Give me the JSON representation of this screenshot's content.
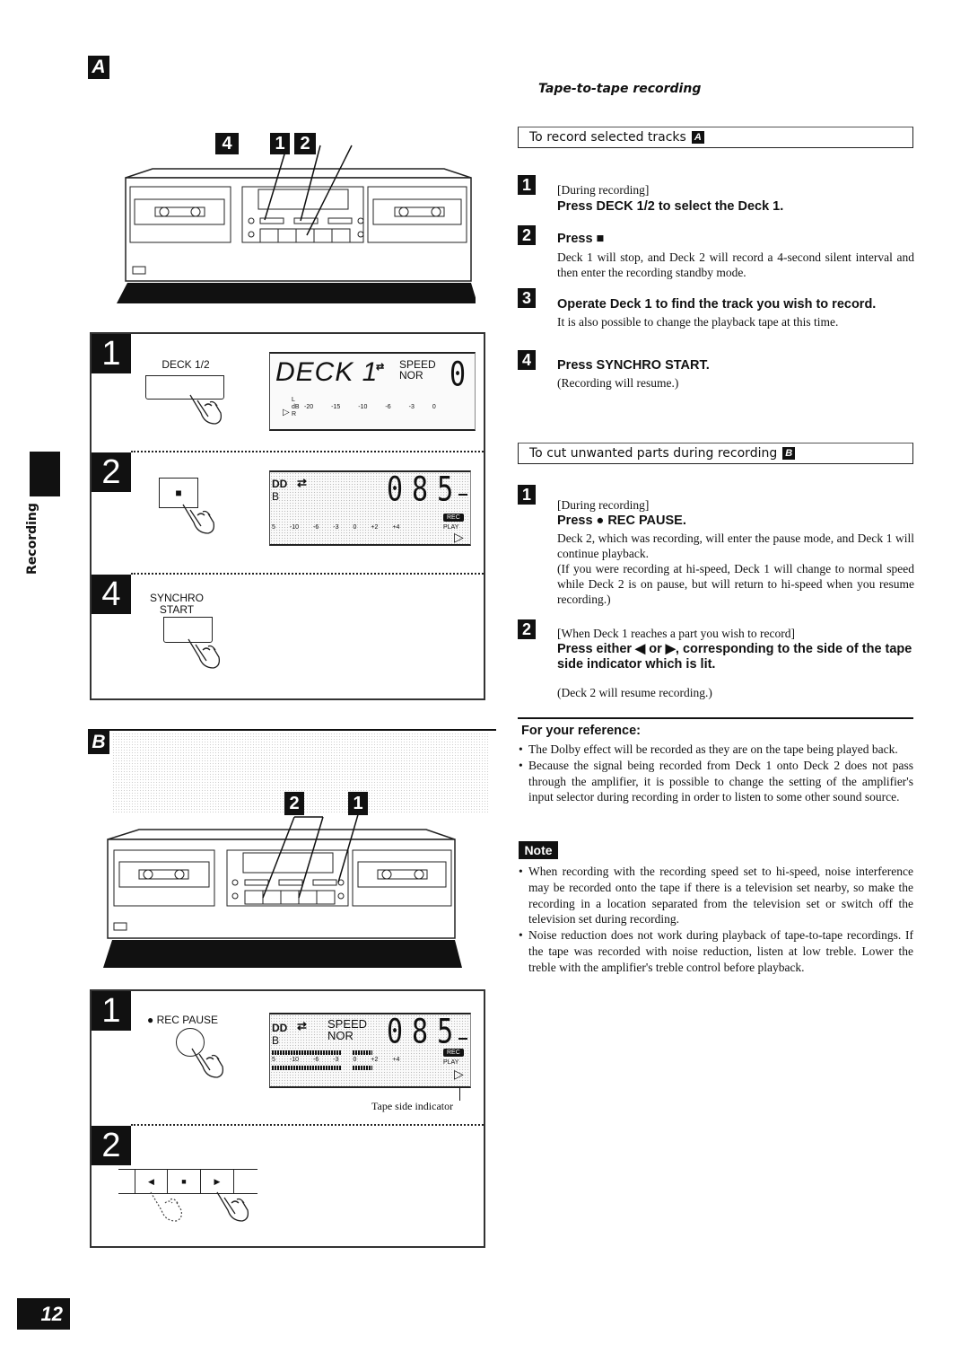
{
  "page": {
    "section_letter_a": "A",
    "section_letter_b": "B",
    "side_tab_label": "Recording",
    "page_number": "12"
  },
  "header": {
    "title": "Tape-to-tape recording"
  },
  "section_a": {
    "title": "To record selected tracks",
    "badge": "A",
    "steps": [
      {
        "num": "1",
        "condition": "[During recording]",
        "instruction": "Press DECK 1/2 to select the Deck 1.",
        "description": ""
      },
      {
        "num": "2",
        "condition": "",
        "instruction": "Press ■",
        "description": "Deck 1 will stop, and Deck 2 will record a 4-second silent interval and then enter the recording standby mode."
      },
      {
        "num": "3",
        "condition": "",
        "instruction": "Operate Deck 1 to find the track you wish to record.",
        "description": "It is also possible to change the playback tape at this time."
      },
      {
        "num": "4",
        "condition": "",
        "instruction": "Press SYNCHRO START.",
        "description": "(Recording will resume.)"
      }
    ]
  },
  "section_b": {
    "title": "To cut unwanted parts during recording",
    "badge": "B",
    "steps": [
      {
        "num": "1",
        "condition": "[During recording]",
        "instruction": "Press ● REC PAUSE.",
        "description": "Deck 2, which was recording, will enter the pause mode, and Deck 1 will continue playback.",
        "description2": "(If you were recording at hi-speed, Deck 1 will change to normal speed while Deck 2 is on pause, but will return to hi-speed when you resume recording.)"
      },
      {
        "num": "2",
        "condition": "[When Deck 1 reaches a part you wish to record]",
        "instruction": "Press either ◀ or ▶, corresponding to the side of the tape side indicator which is lit.",
        "description": "(Deck 2 will resume recording.)"
      }
    ]
  },
  "reference": {
    "title": "For your reference:",
    "items": [
      "The Dolby effect will be recorded as they are on the tape being played back.",
      "Because the signal being recorded from Deck 1 onto Deck 2 does not pass through the amplifier, it is possible to change the setting of the amplifier's input selector during recording in order to listen to some other sound source."
    ]
  },
  "note": {
    "label": "Note",
    "items": [
      "When recording with the recording speed set to hi-speed, noise interference may be recorded onto the tape if there is a television set nearby, so make the recording in a location separated from the television set or switch off the television set during recording.",
      "Noise reduction does not work during playback of tape-to-tape recordings. If the tape was recorded with noise reduction, listen at low treble. Lower the treble with the amplifier's treble control before playback."
    ]
  },
  "figure_a": {
    "callouts": [
      "4",
      "1",
      "2"
    ],
    "panel1": {
      "step": "1",
      "button_label": "DECK 1/2",
      "lcd": {
        "deck_text": "DECK 1",
        "speed_label": "SPEED",
        "speed_value": "NOR",
        "counter": "0",
        "channel_l": "L",
        "db_label": "dB",
        "channel_r": "R",
        "scale": [
          "-20",
          "-15",
          "-10",
          "-6",
          "-3",
          "0"
        ]
      }
    },
    "panel2": {
      "step": "2",
      "button_symbol": "■",
      "lcd": {
        "dolby": "DD",
        "b": "B",
        "counter": "085",
        "rec_badge": "REC",
        "play_label": "PLAY",
        "scale": [
          "5",
          "-10",
          "-6",
          "-3",
          "0",
          "+2",
          "+4"
        ]
      }
    },
    "panel4": {
      "step": "4",
      "button_label_1": "SYNCHRO",
      "button_label_2": "START"
    }
  },
  "figure_b": {
    "callouts": [
      "2",
      "1"
    ],
    "panel1": {
      "step": "1",
      "button_label": "● REC PAUSE",
      "lcd": {
        "dolby": "DD",
        "b": "B",
        "speed_label": "SPEED",
        "speed_value": "NOR",
        "counter": "085",
        "rec_badge": "REC",
        "play_label": "PLAY",
        "scale": [
          "5",
          "-10",
          "-6",
          "-3",
          "0",
          "+2",
          "+4"
        ]
      },
      "caption": "Tape side indicator"
    },
    "panel2": {
      "step": "2",
      "buttons": [
        "◀",
        "■",
        "▶"
      ]
    }
  }
}
